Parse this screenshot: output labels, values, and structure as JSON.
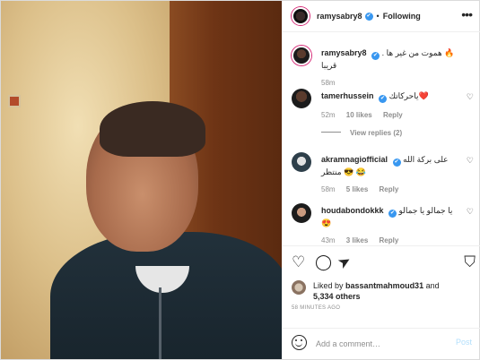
{
  "header": {
    "username": "ramysabry8",
    "verified_mark": "✔",
    "separator": "•",
    "follow_status": "Following",
    "more_icon": "more-horizontal-icon"
  },
  "caption": {
    "username": "ramysabry8",
    "verified_mark": "✔",
    "text": "🔥 هموت من غير ها . قريبا",
    "time": "58m"
  },
  "comments": [
    {
      "username": "tamerhussein",
      "verified_mark": "✔",
      "text": "❤️ياحركاتك",
      "time": "52m",
      "likes": "10 likes",
      "reply": "Reply"
    },
    {
      "username": "akramnagiofficial",
      "verified_mark": "✔",
      "text": "على بركة الله 😂 😎 منتظر",
      "time": "58m",
      "likes": "5 likes",
      "reply": "Reply"
    },
    {
      "username": "houdabondokkk",
      "verified_mark": "✔",
      "text": "يا جمالو يا جمالو 😍",
      "time": "43m",
      "likes": "3 likes",
      "reply": "Reply"
    }
  ],
  "view_replies": "View replies (2)",
  "actions": {
    "like_icon": "heart-icon",
    "comment_icon": "comment-icon",
    "share_icon": "share-icon",
    "save_icon": "bookmark-icon",
    "glyph_like": "♡",
    "glyph_comment": "◯",
    "glyph_share": "➤",
    "glyph_save": "⛉",
    "glyph_heart_small": "♡"
  },
  "likes": {
    "prefix": "Liked by",
    "user": "bassantmahmoud31",
    "connector": "and",
    "others": "5,334 others"
  },
  "timestamp": "58 MINUTES AGO",
  "add_comment": {
    "placeholder": "Add a comment…",
    "post_label": "Post"
  },
  "colors": {
    "verified": "#3897f0",
    "muted": "#8e8e8e",
    "post_disabled": "#b2dffc",
    "story_ring": "#d62976"
  }
}
